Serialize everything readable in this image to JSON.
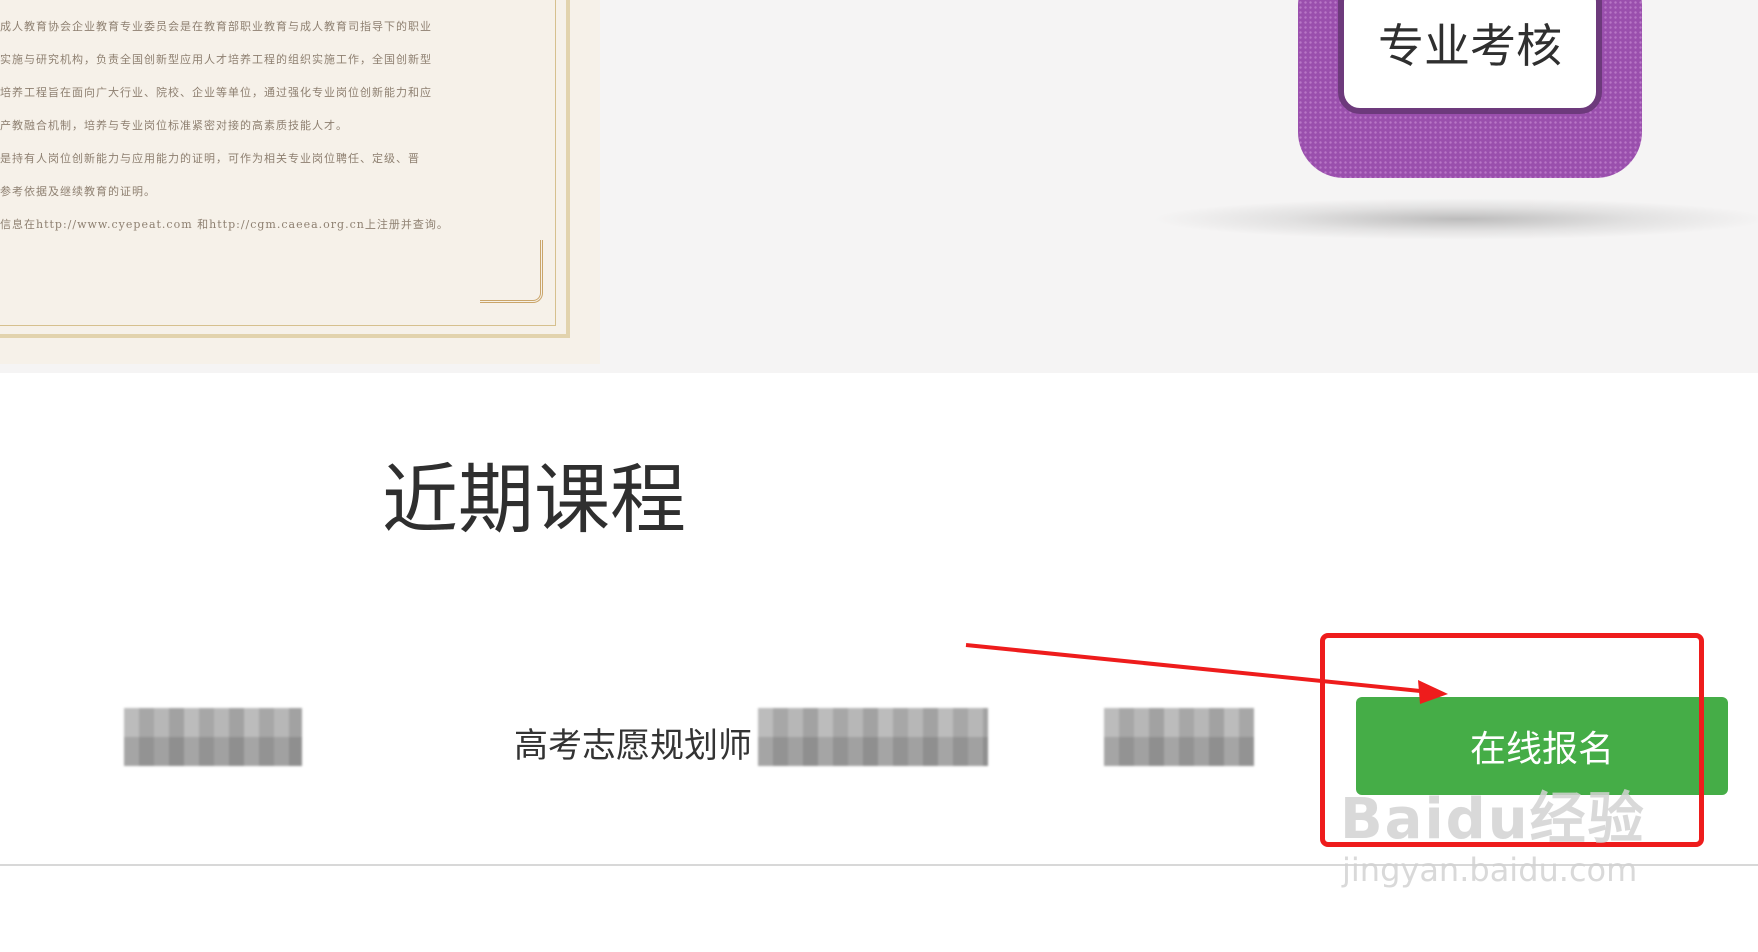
{
  "banner": {
    "certificate_lines": [
      "成人教育协会企业教育专业委员会是在教育部职业教育与成人教育司指导下的职业",
      "实施与研究机构，负责全国创新型应用人才培养工程的组织实施工作，全国创新型",
      "培养工程旨在面向广大行业、院校、企业等单位，通过强化专业岗位创新能力和应",
      "产教融合机制，培养与专业岗位标准紧密对接的高素质技能人才。",
      "是持有人岗位创新能力与应用能力的证明，可作为相关专业岗位聘任、定级、晋",
      "参考依据及继续教育的证明。",
      "信息在http://www.cyepeat.com 和http://cgm.caeea.org.cn上注册并查询。"
    ],
    "badge_text": "专业考核"
  },
  "section": {
    "title": "近期课程"
  },
  "course": {
    "name": "高考志愿规划师",
    "signup_label": "在线报名"
  },
  "watermark": {
    "logo": "Baidu经验",
    "url": "jingyan.baidu.com"
  },
  "colors": {
    "signup_button": "#45ad47",
    "highlight": "#ee1c1c",
    "badge": "#9a4fad"
  }
}
